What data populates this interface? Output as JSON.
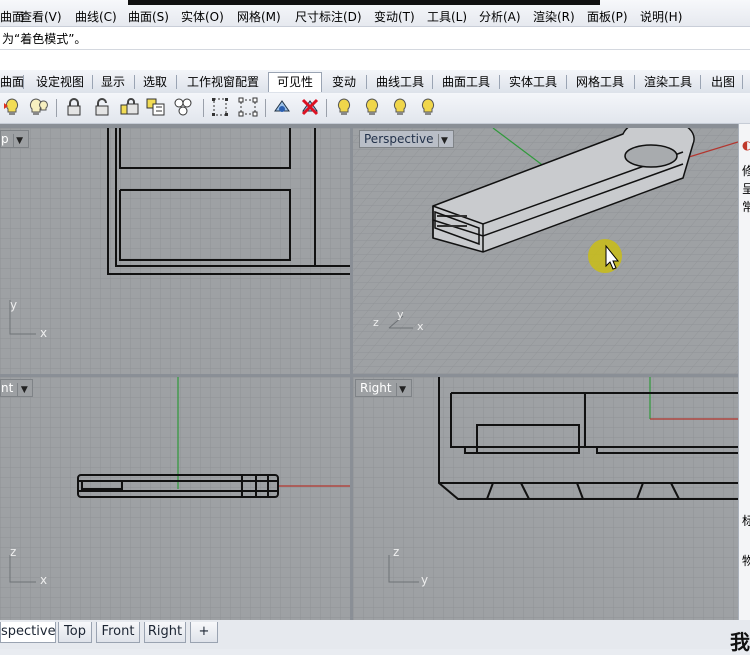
{
  "menu": [
    "曲面",
    "查看(V)",
    "曲线(C)",
    "曲面(S)",
    "实体(O)",
    "网格(M)",
    "尺寸标注(D)",
    "变动(T)",
    "工具(L)",
    "分析(A)",
    "渲染(R)",
    "面板(P)",
    "说明(H)"
  ],
  "command_text": "为“着色模式”。",
  "tabs": [
    "曲面",
    "设定视图",
    "显示",
    "选取",
    "工作视窗配置",
    "可见性",
    "变动",
    "曲线工具",
    "曲面工具",
    "实体工具",
    "网格工具",
    "渲染工具",
    "出图"
  ],
  "active_tab": "可见性",
  "toolbar_icons": [
    "show-icon",
    "hide-icon",
    "lock-icon",
    "unlock-icon",
    "lock-swap-icon",
    "hide-swap-icon",
    "show-selected-icon",
    "points-on-icon",
    "points-off-icon",
    "hide-points-icon",
    "delete-icon",
    "light-bulb-icon",
    "light-bulb-icon",
    "light-bulb-icon",
    "light-bulb-icon"
  ],
  "viewports": {
    "top": {
      "label": "p",
      "axis_y": "y",
      "axis_x": "x"
    },
    "perspective": {
      "label": "Perspective",
      "axis_y": "y",
      "axis_x": "x",
      "axis_z": "z"
    },
    "front": {
      "label": "nt",
      "axis_z": "z",
      "axis_x": "x"
    },
    "right": {
      "label": "Right",
      "axis_z": "z",
      "axis_y": "y"
    }
  },
  "side_panel_chars": [
    "修",
    "呈",
    "常",
    "标",
    "物"
  ],
  "bottom_tabs": [
    "spective",
    "Top",
    "Front",
    "Right",
    "+"
  ],
  "active_bottom_tab": "spective",
  "watermark": "我",
  "colors": {
    "viewport_bg": "#9ea1a4",
    "grid_line": "#8e9195",
    "x_axis": "#b3362f",
    "y_axis": "#2f9a3b",
    "highlight": "#c9bd16"
  }
}
